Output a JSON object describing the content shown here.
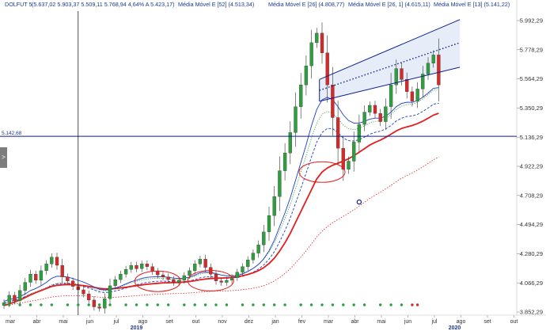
{
  "header": {
    "symbol": "DOLFUT 5",
    "ohlc": "(5.637,02  5.903,37  5.509,11  5.768,94  4,64%  A 5.423,17)",
    "ma1": "Média Móvel E [52] (4.513,34)",
    "ma2": "Média Móvel E [26] (4.808,77)",
    "ma3": "Média Móvel E [26, 1] (4.615,11)",
    "ma4": "Média Móvel E [13] (5.141,22)"
  },
  "left_tab_label": ">",
  "chart_data": {
    "type": "candlestick",
    "ylim": [
      3852.29,
      5992.29
    ],
    "y_ticks": [
      "5.992,29",
      "5.778,29",
      "5.564,29",
      "5.350,29",
      "5.136,29",
      "4.922,29",
      "4.708,29",
      "4.494,29",
      "4.280,29",
      "4.066,29",
      "3.852,29"
    ],
    "x_ticks": [
      "mar",
      "abr",
      "mai",
      "jun",
      "jul",
      "ago",
      "set",
      "out",
      "nov",
      "dez",
      "jan",
      "fev",
      "mar",
      "abr",
      "mai",
      "jun",
      "jul",
      "ago",
      "set",
      "out",
      "nov"
    ],
    "x_years": [
      {
        "label": "2019",
        "at": 5
      },
      {
        "label": "2020",
        "at": 17
      }
    ],
    "horizontal_line": {
      "value": 5142.68,
      "label": "5.142,68"
    },
    "crosshair_x": 14.0,
    "colors": {
      "up": "#2e9e3e",
      "down": "#d62a2a",
      "ma_red": "#e41e1e",
      "ma_blue": "#1c3ec9",
      "ma_green": "#2e9e3e",
      "channel": "#0b1f8f",
      "crosshair": "#000000"
    },
    "closes": [
      3920,
      3975,
      3935,
      4010,
      4070,
      4130,
      4085,
      4155,
      4205,
      4255,
      4195,
      4110,
      4080,
      4040,
      4015,
      3985,
      3940,
      3890,
      3880,
      3950,
      4045,
      4090,
      4130,
      4165,
      4195,
      4170,
      4205,
      4185,
      4150,
      4125,
      4110,
      4090,
      4070,
      4085,
      4120,
      4155,
      4205,
      4240,
      4180,
      4130,
      4080,
      4070,
      4085,
      4105,
      4145,
      4185,
      4235,
      4285,
      4345,
      4440,
      4560,
      4700,
      4890,
      5020,
      5170,
      5360,
      5520,
      5660,
      5830,
      5900,
      5755,
      5520,
      5280,
      5055,
      4900,
      4960,
      5100,
      5230,
      5320,
      5370,
      5310,
      5250,
      5360,
      5520,
      5640,
      5560,
      5470,
      5400,
      5490,
      5600,
      5680,
      5740,
      5520
    ],
    "ma_red": [
      3900,
      3912,
      3925,
      3940,
      3958,
      3978,
      3995,
      4010,
      4025,
      4040,
      4048,
      4052,
      4054,
      4053,
      4050,
      4046,
      4040,
      4033,
      4026,
      4022,
      4022,
      4025,
      4029,
      4034,
      4040,
      4046,
      4051,
      4056,
      4060,
      4063,
      4066,
      4067,
      4068,
      4069,
      4072,
      4076,
      4082,
      4089,
      4094,
      4098,
      4100,
      4101,
      4103,
      4106,
      4111,
      4118,
      4128,
      4140,
      4156,
      4178,
      4208,
      4248,
      4300,
      4360,
      4430,
      4510,
      4590,
      4670,
      4750,
      4830,
      4880,
      4910,
      4930,
      4945,
      4960,
      4978,
      5000,
      5025,
      5052,
      5078,
      5098,
      5115,
      5135,
      5158,
      5182,
      5200,
      5212,
      5222,
      5236,
      5254,
      5275,
      5298,
      5312
    ],
    "ma_blue": [
      3930,
      3945,
      3950,
      3965,
      3985,
      4010,
      4025,
      4045,
      4070,
      4100,
      4115,
      4114,
      4108,
      4098,
      4085,
      4072,
      4055,
      4036,
      4019,
      4014,
      4018,
      4028,
      4042,
      4058,
      4075,
      4086,
      4099,
      4107,
      4110,
      4112,
      4111,
      4107,
      4101,
      4098,
      4101,
      4108,
      4122,
      4140,
      4146,
      4143,
      4134,
      4124,
      4118,
      4116,
      4121,
      4132,
      4150,
      4172,
      4201,
      4243,
      4302,
      4379,
      4480,
      4580,
      4690,
      4820,
      4950,
      5080,
      5220,
      5340,
      5410,
      5430,
      5410,
      5360,
      5300,
      5258,
      5240,
      5240,
      5252,
      5269,
      5276,
      5276,
      5290,
      5320,
      5360,
      5384,
      5393,
      5392,
      5405,
      5430,
      5460,
      5495,
      5500
    ],
    "ma_blue_dash": [
      3920,
      3930,
      3938,
      3950,
      3965,
      3982,
      3995,
      4010,
      4028,
      4048,
      4058,
      4062,
      4062,
      4058,
      4050,
      4040,
      4028,
      4014,
      4000,
      3995,
      3998,
      4006,
      4016,
      4028,
      4042,
      4052,
      4062,
      4070,
      4075,
      4078,
      4079,
      4077,
      4074,
      4072,
      4075,
      4080,
      4090,
      4103,
      4110,
      4111,
      4107,
      4102,
      4100,
      4101,
      4106,
      4114,
      4127,
      4144,
      4167,
      4198,
      4240,
      4295,
      4368,
      4450,
      4542,
      4650,
      4760,
      4872,
      4990,
      5100,
      5170,
      5200,
      5198,
      5170,
      5130,
      5110,
      5108,
      5118,
      5136,
      5158,
      5172,
      5180,
      5196,
      5222,
      5255,
      5276,
      5288,
      5292,
      5304,
      5325,
      5350,
      5378,
      5385
    ],
    "ma_green": [
      3910,
      3925,
      3935,
      3950,
      3968,
      3988,
      4000,
      4015,
      4032,
      4052,
      4062,
      4066,
      4066,
      4062,
      4055,
      4046,
      4035,
      4022,
      4010,
      4008,
      4014,
      4025,
      4038,
      4053,
      4068,
      4078,
      4088,
      4095,
      4098,
      4100,
      4099,
      4096,
      4092,
      4091,
      4095,
      4102,
      4115,
      4131,
      4138,
      4137,
      4131,
      4124,
      4120,
      4120,
      4126,
      4136,
      4153,
      4174,
      4202,
      4240,
      4292,
      4360,
      4448,
      4540,
      4640,
      4760,
      4880,
      5000,
      5130,
      5240,
      5305,
      5325,
      5312,
      5272,
      5225,
      5198,
      5192,
      5200,
      5218,
      5240,
      5252,
      5256,
      5272,
      5302,
      5340,
      5364,
      5376,
      5378,
      5392,
      5418,
      5448,
      5482,
      5488
    ],
    "ma_red_dotted": [
      3900,
      3905,
      3911,
      3917,
      3924,
      3932,
      3939,
      3946,
      3954,
      3962,
      3967,
      3970,
      3972,
      3973,
      3972,
      3971,
      3968,
      3965,
      3961,
      3959,
      3959,
      3961,
      3963,
      3966,
      3969,
      3972,
      3975,
      3978,
      3981,
      3983,
      3985,
      3986,
      3987,
      3988,
      3990,
      3992,
      3995,
      3999,
      4002,
      4004,
      4005,
      4006,
      4007,
      4009,
      4012,
      4016,
      4021,
      4027,
      4035,
      4046,
      4061,
      4080,
      4105,
      4135,
      4170,
      4212,
      4256,
      4302,
      4352,
      4404,
      4446,
      4480,
      4508,
      4532,
      4555,
      4578,
      4603,
      4630,
      4658,
      4686,
      4710,
      4732,
      4756,
      4782,
      4810,
      4834,
      4855,
      4874,
      4895,
      4918,
      4943,
      4970,
      4990
    ],
    "channel": {
      "lower": [
        [
          59.5,
          5400
        ],
        [
          86,
          5650
        ]
      ],
      "upper": [
        [
          59.5,
          5560
        ],
        [
          86,
          6000
        ]
      ],
      "mid": [
        [
          59.5,
          5480
        ],
        [
          86,
          5830
        ]
      ]
    },
    "ellipses": [
      {
        "x": 29,
        "y": 4078
      },
      {
        "x": 39,
        "y": 4082
      },
      {
        "x": 60,
        "y": 4880
      }
    ],
    "marker_circle": {
      "x": 67,
      "y": 4660
    },
    "bottom_dots": {
      "up": [
        1,
        3,
        5,
        7,
        9,
        12,
        14,
        16,
        18,
        20,
        23,
        25,
        27,
        29,
        31,
        34,
        36,
        38,
        40,
        42,
        45,
        47,
        49,
        51,
        53,
        56,
        58,
        60,
        62,
        64,
        66,
        68,
        71,
        73,
        75
      ],
      "down": [
        77,
        78
      ]
    }
  }
}
